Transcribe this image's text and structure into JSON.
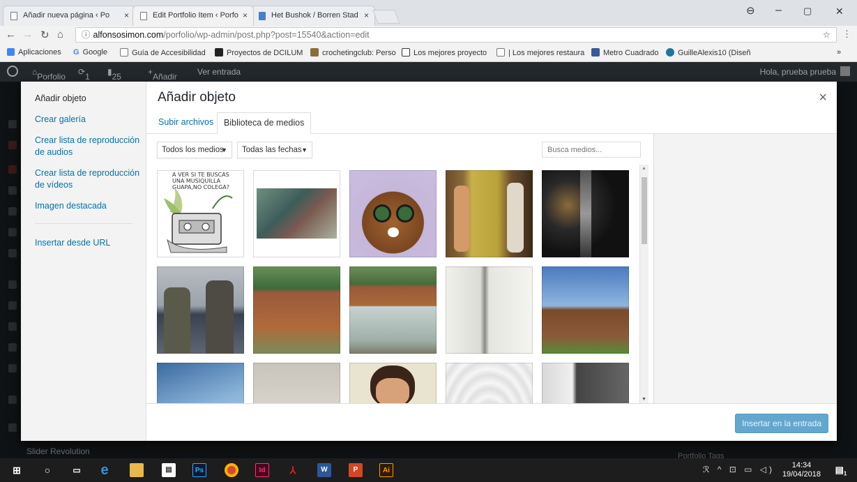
{
  "browser": {
    "tabs": [
      {
        "label": "Añadir nueva página ‹ Po",
        "close": "×"
      },
      {
        "label": "Edit Portfolio Item ‹ Porfo",
        "close": "×"
      },
      {
        "label": "Het Bushok / Borren Stad",
        "close": "×"
      }
    ],
    "window_controls": {
      "minimize": "–",
      "maximize": "▢",
      "close": "✕"
    },
    "url_host": "alfonsosimon.com",
    "url_path": "/porfolio/wp-admin/post.php?post=15540&action=edit",
    "bookmarks": [
      "Aplicaciones",
      "Google",
      "Guía de Accesibilidad",
      "Proyectos de DCILUM",
      "crochetingclub: Perso",
      "Los mejores proyecto",
      "| Los mejores restaura",
      "Metro Cuadrado",
      "GuilleAlexis10 (Diseñ"
    ],
    "bookmarks_more": "»"
  },
  "adminbar": {
    "site": "Porfolio",
    "updates": "1",
    "comments": "25",
    "new": "Añadir",
    "view": "Ver entrada",
    "greeting": "Hola, prueba prueba"
  },
  "modal": {
    "title": "Añadir objeto",
    "close": "×",
    "menu": [
      "Añadir objeto",
      "Crear galería",
      "Crear lista de reproducción de audios",
      "Crear lista de reproducción de vídeos",
      "Imagen destacada",
      "Insertar desde URL"
    ],
    "router_tabs": [
      "Subir archivos",
      "Biblioteca de medios"
    ],
    "filter_type": "Todos los medios",
    "filter_date": "Todas las fechas",
    "search_placeholder": "Busca medios...",
    "thumb0_text": "A VER SI TE BUSCAS UNA MUSIQUILLA GUAPA,NO COLEGA?",
    "insert_button": "Insertar en la entrada"
  },
  "background": {
    "slider_label": "Slider Revolution",
    "portfolio_tags": "Portfolio Tags"
  },
  "taskbar": {
    "time": "14:34",
    "date": "19/04/2018",
    "notifications": "1"
  },
  "colors": {
    "link": "#0073aa",
    "button": "#63a7cf",
    "adminbar": "#23282d"
  }
}
